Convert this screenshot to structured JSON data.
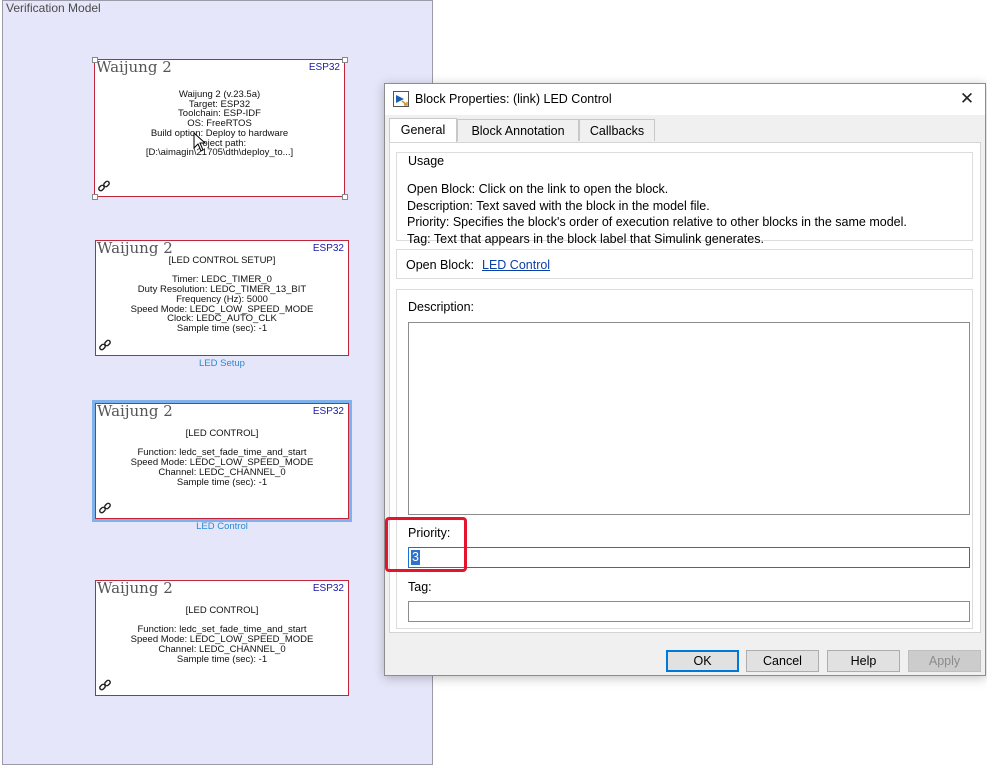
{
  "canvas": {
    "subsystem_title": "Verification Model",
    "blocks": [
      {
        "brand": "Waijung 2",
        "chip": "ESP32",
        "lines": [
          "Waijung 2 (v.23.5a)",
          "Target: ESP32",
          "Toolchain: ESP-IDF",
          "OS: FreeRTOS",
          "Build option: Deploy to hardware",
          "Project path:",
          "[D:\\aimagin\\21705\\dth\\deploy_to...]"
        ]
      },
      {
        "brand": "Waijung 2",
        "chip": "ESP32",
        "lines": [
          "[LED CONTROL SETUP]",
          "",
          "Timer: LEDC_TIMER_0",
          "Duty Resolution: LEDC_TIMER_13_BIT",
          "Frequency (Hz): 5000",
          "Speed Mode: LEDC_LOW_SPEED_MODE",
          "Clock: LEDC_AUTO_CLK",
          "Sample time (sec): -1"
        ],
        "label": "LED Setup"
      },
      {
        "brand": "Waijung 2",
        "chip": "ESP32",
        "lines": [
          "[LED CONTROL]",
          "",
          "Function: ledc_set_fade_time_and_start",
          "Speed Mode: LEDC_LOW_SPEED_MODE",
          "Channel: LEDC_CHANNEL_0",
          "Sample time (sec): -1"
        ],
        "label": "LED Control"
      },
      {
        "brand": "Waijung 2",
        "chip": "ESP32",
        "lines": [
          "[LED CONTROL]",
          "",
          "Function: ledc_set_fade_time_and_start",
          "Speed Mode: LEDC_LOW_SPEED_MODE",
          "Channel: LEDC_CHANNEL_0",
          "Sample time (sec): -1"
        ]
      }
    ]
  },
  "dialog": {
    "title": "Block Properties: (link) LED Control",
    "close_glyph": "✕",
    "tabs": [
      {
        "label": "General",
        "active": true
      },
      {
        "label": "Block Annotation",
        "active": false
      },
      {
        "label": "Callbacks",
        "active": false
      }
    ],
    "usage": {
      "legend": "Usage",
      "lines": [
        "Open Block: Click on the link to open the block.",
        "Description: Text saved with the block in the model file.",
        "Priority: Specifies the block's order of execution relative to other blocks in the same model.",
        "Tag: Text that appears in the block label that Simulink generates."
      ]
    },
    "open_block": {
      "label": "Open Block:",
      "link": "LED Control"
    },
    "description": {
      "label": "Description:",
      "value": ""
    },
    "priority": {
      "label": "Priority:",
      "value": "3"
    },
    "tag": {
      "label": "Tag:",
      "value": ""
    },
    "buttons": {
      "ok": "OK",
      "cancel": "Cancel",
      "help": "Help",
      "apply": "Apply"
    }
  },
  "colors": {
    "canvas_bg": "#e6e6fa",
    "block_border": "#c0253a",
    "highlight": "#e5142e",
    "accent": "#0078d7"
  },
  "icons": {
    "block_link": "chain-link-icon",
    "dialog_app": "simulink-icon",
    "close": "close-icon"
  }
}
